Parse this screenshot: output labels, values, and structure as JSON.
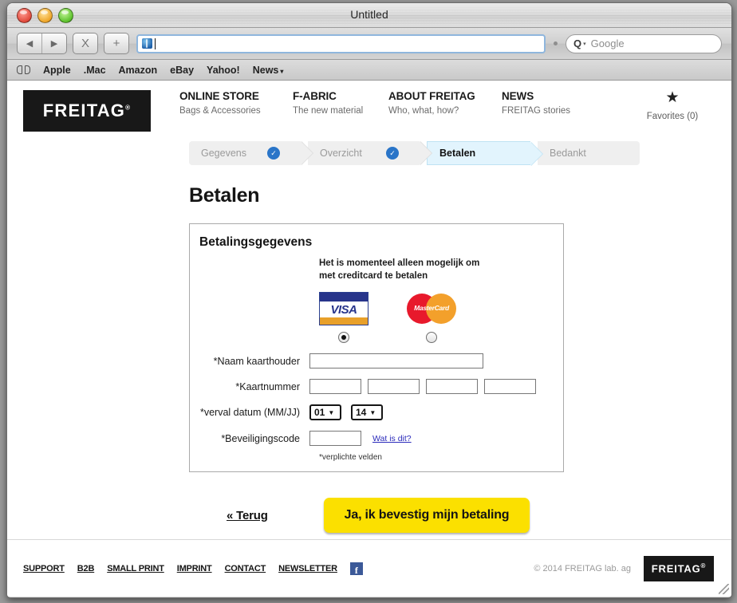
{
  "browser": {
    "window_title": "Untitled",
    "traffic_lights": [
      "close",
      "minimize",
      "zoom"
    ],
    "toolbar": {
      "back_icon": "◀",
      "forward_icon": "▶",
      "stop_label": "X",
      "add_label": "+",
      "url_value": "",
      "favicon": "globe-icon",
      "search_q": "Q",
      "search_arrow": "▾",
      "search_placeholder": "Google"
    },
    "bookmarks": {
      "book_icon": "book-icon",
      "items": [
        {
          "label": "Apple"
        },
        {
          "label": ".Mac"
        },
        {
          "label": "Amazon"
        },
        {
          "label": "eBay"
        },
        {
          "label": "Yahoo!"
        },
        {
          "label": "News",
          "arrow": "▾"
        }
      ]
    }
  },
  "site": {
    "logo": "FREITAG",
    "logo_mark": "®",
    "nav": [
      {
        "title": "ONLINE STORE",
        "sub": "Bags & Accessories"
      },
      {
        "title": "F-ABRIC",
        "sub": "The new material"
      },
      {
        "title": "ABOUT FREITAG",
        "sub": "Who, what, how?"
      },
      {
        "title": "NEWS",
        "sub": "FREITAG stories"
      }
    ],
    "favorites": {
      "icon": "★",
      "label": "Favorites (0)"
    }
  },
  "steps": [
    {
      "label": "Gegevens",
      "state": "done",
      "check": "✓"
    },
    {
      "label": "Overzicht",
      "state": "done",
      "check": "✓"
    },
    {
      "label": "Betalen",
      "state": "current"
    },
    {
      "label": "Bedankt",
      "state": "upcoming"
    }
  ],
  "main": {
    "page_title": "Betalen",
    "panel_title": "Betalingsgegevens",
    "cc_note": "Het is momenteel alleen mogelijk om met creditcard te betalen",
    "cards": [
      {
        "name": "VISA",
        "word": "VISA",
        "selected": true
      },
      {
        "name": "MasterCard",
        "word": "MasterCard",
        "selected": false
      }
    ],
    "fields": {
      "cardholder_label": "*Naam kaarthouder",
      "cardholder_value": "",
      "cardnumber_label": "*Kaartnummer",
      "cardnumber_values": [
        "",
        "",
        "",
        ""
      ],
      "expiry_label": "*verval datum (MM/JJ)",
      "expiry_month": "01",
      "expiry_year": "14",
      "select_arrow": "▼",
      "cvc_label": "*Beveiligingscode",
      "cvc_value": "",
      "cvc_help": "Wat is dit?"
    },
    "required_note": "*verplichte velden",
    "back_label": "« Terug",
    "confirm_label": "Ja, ik bevestig mijn betaling"
  },
  "footer": {
    "links": [
      "SUPPORT",
      "B2B",
      "SMALL PRINT",
      "IMPRINT",
      "CONTACT",
      "NEWSLETTER"
    ],
    "facebook_glyph": "f",
    "copyright": "© 2014 FREITAG lab. ag",
    "logo": "FREITAG",
    "logo_mark": "®"
  },
  "colors": {
    "accent_yellow": "#fbe000",
    "step_active": "#e2f4fd",
    "step_check": "#2a75c8",
    "brand_black": "#181818",
    "link_blue": "#2b2bbb"
  }
}
